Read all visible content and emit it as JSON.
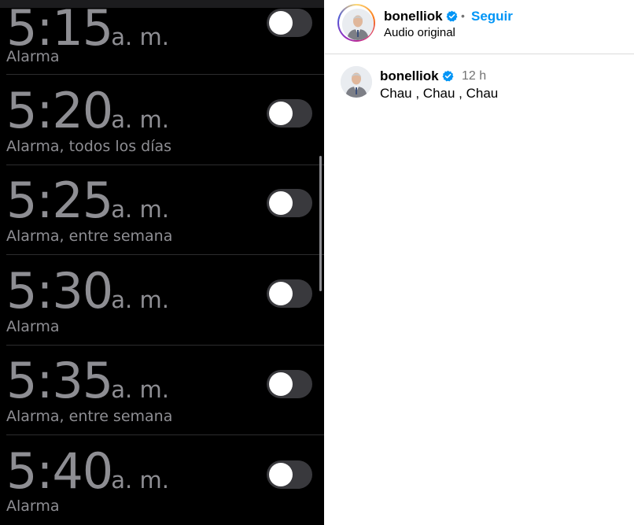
{
  "alarms": [
    {
      "hm": "5:15",
      "ampm": "a. m.",
      "label": "Alarma",
      "enabled": false
    },
    {
      "hm": "5:20",
      "ampm": "a. m.",
      "label": "Alarma, todos los días",
      "enabled": false
    },
    {
      "hm": "5:25",
      "ampm": "a. m.",
      "label": "Alarma, entre semana",
      "enabled": false
    },
    {
      "hm": "5:30",
      "ampm": "a. m.",
      "label": "Alarma",
      "enabled": false
    },
    {
      "hm": "5:35",
      "ampm": "a. m.",
      "label": "Alarma, entre semana",
      "enabled": false
    },
    {
      "hm": "5:40",
      "ampm": "a. m.",
      "label": "Alarma",
      "enabled": false
    }
  ],
  "post": {
    "username": "bonelliok",
    "separator": "•",
    "follow_label": "Seguir",
    "subtitle": "Audio original",
    "comment": {
      "username": "bonelliok",
      "time": "12 h",
      "text": "Chau , Chau , Chau"
    }
  },
  "colors": {
    "verified": "#0095f6",
    "follow": "#0095f6",
    "toggle_off": "#39393d"
  },
  "icons": {
    "verified": "verified-badge-icon",
    "avatar": "avatar-image"
  }
}
